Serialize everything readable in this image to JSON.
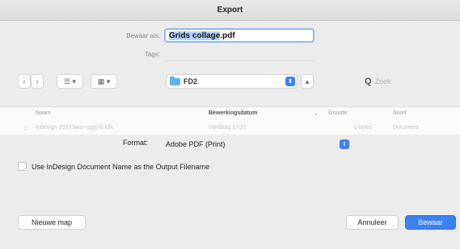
{
  "window": {
    "title": "Export"
  },
  "save_as": {
    "label": "Bewaar als:",
    "value_selected": "Grids collage",
    "value_rest": ".pdf"
  },
  "tags": {
    "label": "Tags:"
  },
  "toolbar": {
    "back_icon": "chevron-left",
    "forward_icon": "chevron-right",
    "view_list_label": "☰ ▾",
    "view_grid_label": "▦ ▾"
  },
  "location": {
    "folder": "FD2",
    "collapse_label": "▴"
  },
  "search": {
    "placeholder": "Zoek"
  },
  "columns": {
    "name": "Naam",
    "modified": "Bewerkingsdatum",
    "size": "Grootte",
    "kind": "Soort"
  },
  "files": [
    {
      "name": "~Indesign 2023 basi~ugyj76.idlk",
      "modified": "Vandaag 17:21",
      "size": "0 bytes",
      "kind": "Document"
    }
  ],
  "format": {
    "label": "Format:",
    "value": "Adobe PDF (Print)"
  },
  "options": {
    "use_document_name_label": "Use InDesign Document Name as the Output Filename"
  },
  "buttons": {
    "new_folder": "Nieuwe map",
    "cancel": "Annuleer",
    "save": "Bewaar"
  },
  "colors": {
    "accent": "#3b82f6",
    "selection": "#b3d3fb",
    "folder": "#5ab6ee"
  }
}
